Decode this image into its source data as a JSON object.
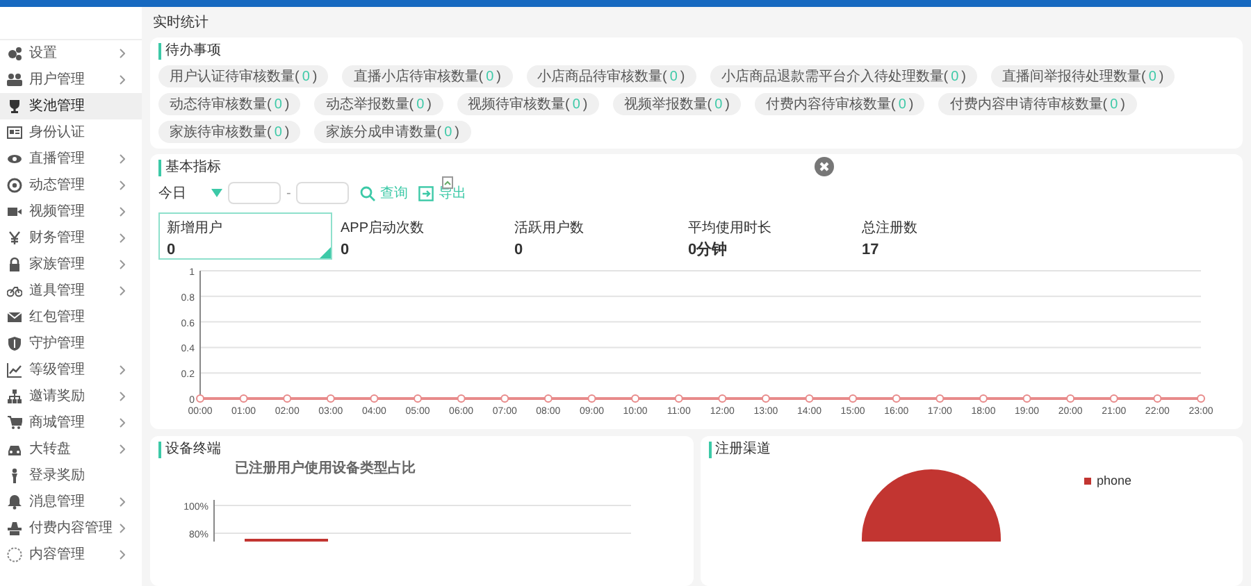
{
  "sidebar": {
    "items": [
      {
        "label": "设置",
        "has_children": true,
        "selected": false
      },
      {
        "label": "用户管理",
        "has_children": true,
        "selected": false
      },
      {
        "label": "奖池管理",
        "has_children": false,
        "selected": true
      },
      {
        "label": "身份认证",
        "has_children": false,
        "selected": false
      },
      {
        "label": "直播管理",
        "has_children": true,
        "selected": false
      },
      {
        "label": "动态管理",
        "has_children": true,
        "selected": false
      },
      {
        "label": "视频管理",
        "has_children": true,
        "selected": false
      },
      {
        "label": "财务管理",
        "has_children": true,
        "selected": false
      },
      {
        "label": "家族管理",
        "has_children": true,
        "selected": false
      },
      {
        "label": "道具管理",
        "has_children": true,
        "selected": false
      },
      {
        "label": "红包管理",
        "has_children": false,
        "selected": false
      },
      {
        "label": "守护管理",
        "has_children": false,
        "selected": false
      },
      {
        "label": "等级管理",
        "has_children": true,
        "selected": false
      },
      {
        "label": "邀请奖励",
        "has_children": true,
        "selected": false
      },
      {
        "label": "商城管理",
        "has_children": true,
        "selected": false
      },
      {
        "label": "大转盘",
        "has_children": true,
        "selected": false
      },
      {
        "label": "登录奖励",
        "has_children": false,
        "selected": false
      },
      {
        "label": "消息管理",
        "has_children": true,
        "selected": false
      },
      {
        "label": "付费内容管理",
        "has_children": true,
        "selected": false
      },
      {
        "label": "内容管理",
        "has_children": true,
        "selected": false
      }
    ]
  },
  "page_title": "实时统计",
  "todo": {
    "title": "待办事项",
    "items": [
      {
        "label": "用户认证待审核数量(",
        "count": "0",
        "close": ")"
      },
      {
        "label": "直播小店待审核数量(",
        "count": "0",
        "close": ")"
      },
      {
        "label": "小店商品待审核数量(",
        "count": "0",
        "close": ")"
      },
      {
        "label": "小店商品退款需平台介入待处理数量(",
        "count": "0",
        "close": ")"
      },
      {
        "label": "直播间举报待处理数量(",
        "count": "0",
        "close": ")"
      },
      {
        "label": "动态待审核数量(",
        "count": "0",
        "close": ")"
      },
      {
        "label": "动态举报数量(",
        "count": "0",
        "close": ")"
      },
      {
        "label": "视频待审核数量(",
        "count": "0",
        "close": ")"
      },
      {
        "label": "视频举报数量(",
        "count": "0",
        "close": ")"
      },
      {
        "label": "付费内容待审核数量(",
        "count": "0",
        "close": ")"
      },
      {
        "label": "付费内容申请待审核数量(",
        "count": "0",
        "close": ")"
      },
      {
        "label": "家族待审核数量(",
        "count": "0",
        "close": ")"
      },
      {
        "label": "家族分成申请数量(",
        "count": "0",
        "close": ")"
      }
    ]
  },
  "basic": {
    "title": "基本指标",
    "filter": {
      "range": "今日",
      "separator": "-",
      "query": "查询",
      "export": "导出"
    },
    "stats": [
      {
        "label": "新增用户",
        "value": "0",
        "selected": true
      },
      {
        "label": "APP启动次数",
        "value": "0",
        "selected": false
      },
      {
        "label": "活跃用户数",
        "value": "0",
        "selected": false
      },
      {
        "label": "平均使用时长",
        "value": "0分钟",
        "selected": false
      },
      {
        "label": "总注册数",
        "value": "17",
        "selected": false
      }
    ],
    "chart_data": {
      "type": "line",
      "grid": true,
      "categories": [
        "00:00",
        "01:00",
        "02:00",
        "03:00",
        "04:00",
        "05:00",
        "06:00",
        "07:00",
        "08:00",
        "09:00",
        "10:00",
        "11:00",
        "12:00",
        "13:00",
        "14:00",
        "15:00",
        "16:00",
        "17:00",
        "18:00",
        "19:00",
        "20:00",
        "21:00",
        "22:00",
        "23:00"
      ],
      "series": [
        {
          "color": "#e88a8a",
          "marker": true,
          "values": [
            0,
            0,
            0,
            0,
            0,
            0,
            0,
            0,
            0,
            0,
            0,
            0,
            0,
            0,
            0,
            0,
            0,
            0,
            0,
            0,
            0,
            0,
            0,
            0
          ]
        }
      ],
      "ylim": [
        0,
        1
      ],
      "yticks": [
        0,
        0.2,
        0.4,
        0.6,
        0.8,
        1
      ]
    }
  },
  "devices": {
    "title": "设备终端",
    "chart_title": "已注册用户使用设备类型占比",
    "y_labels": [
      "100%",
      "80%"
    ]
  },
  "channels": {
    "title": "注册渠道",
    "chart_data": {
      "type": "pie",
      "categories": [
        "phone"
      ],
      "series": [
        {
          "color": "#c23531",
          "values": [
            1
          ]
        }
      ]
    }
  }
}
